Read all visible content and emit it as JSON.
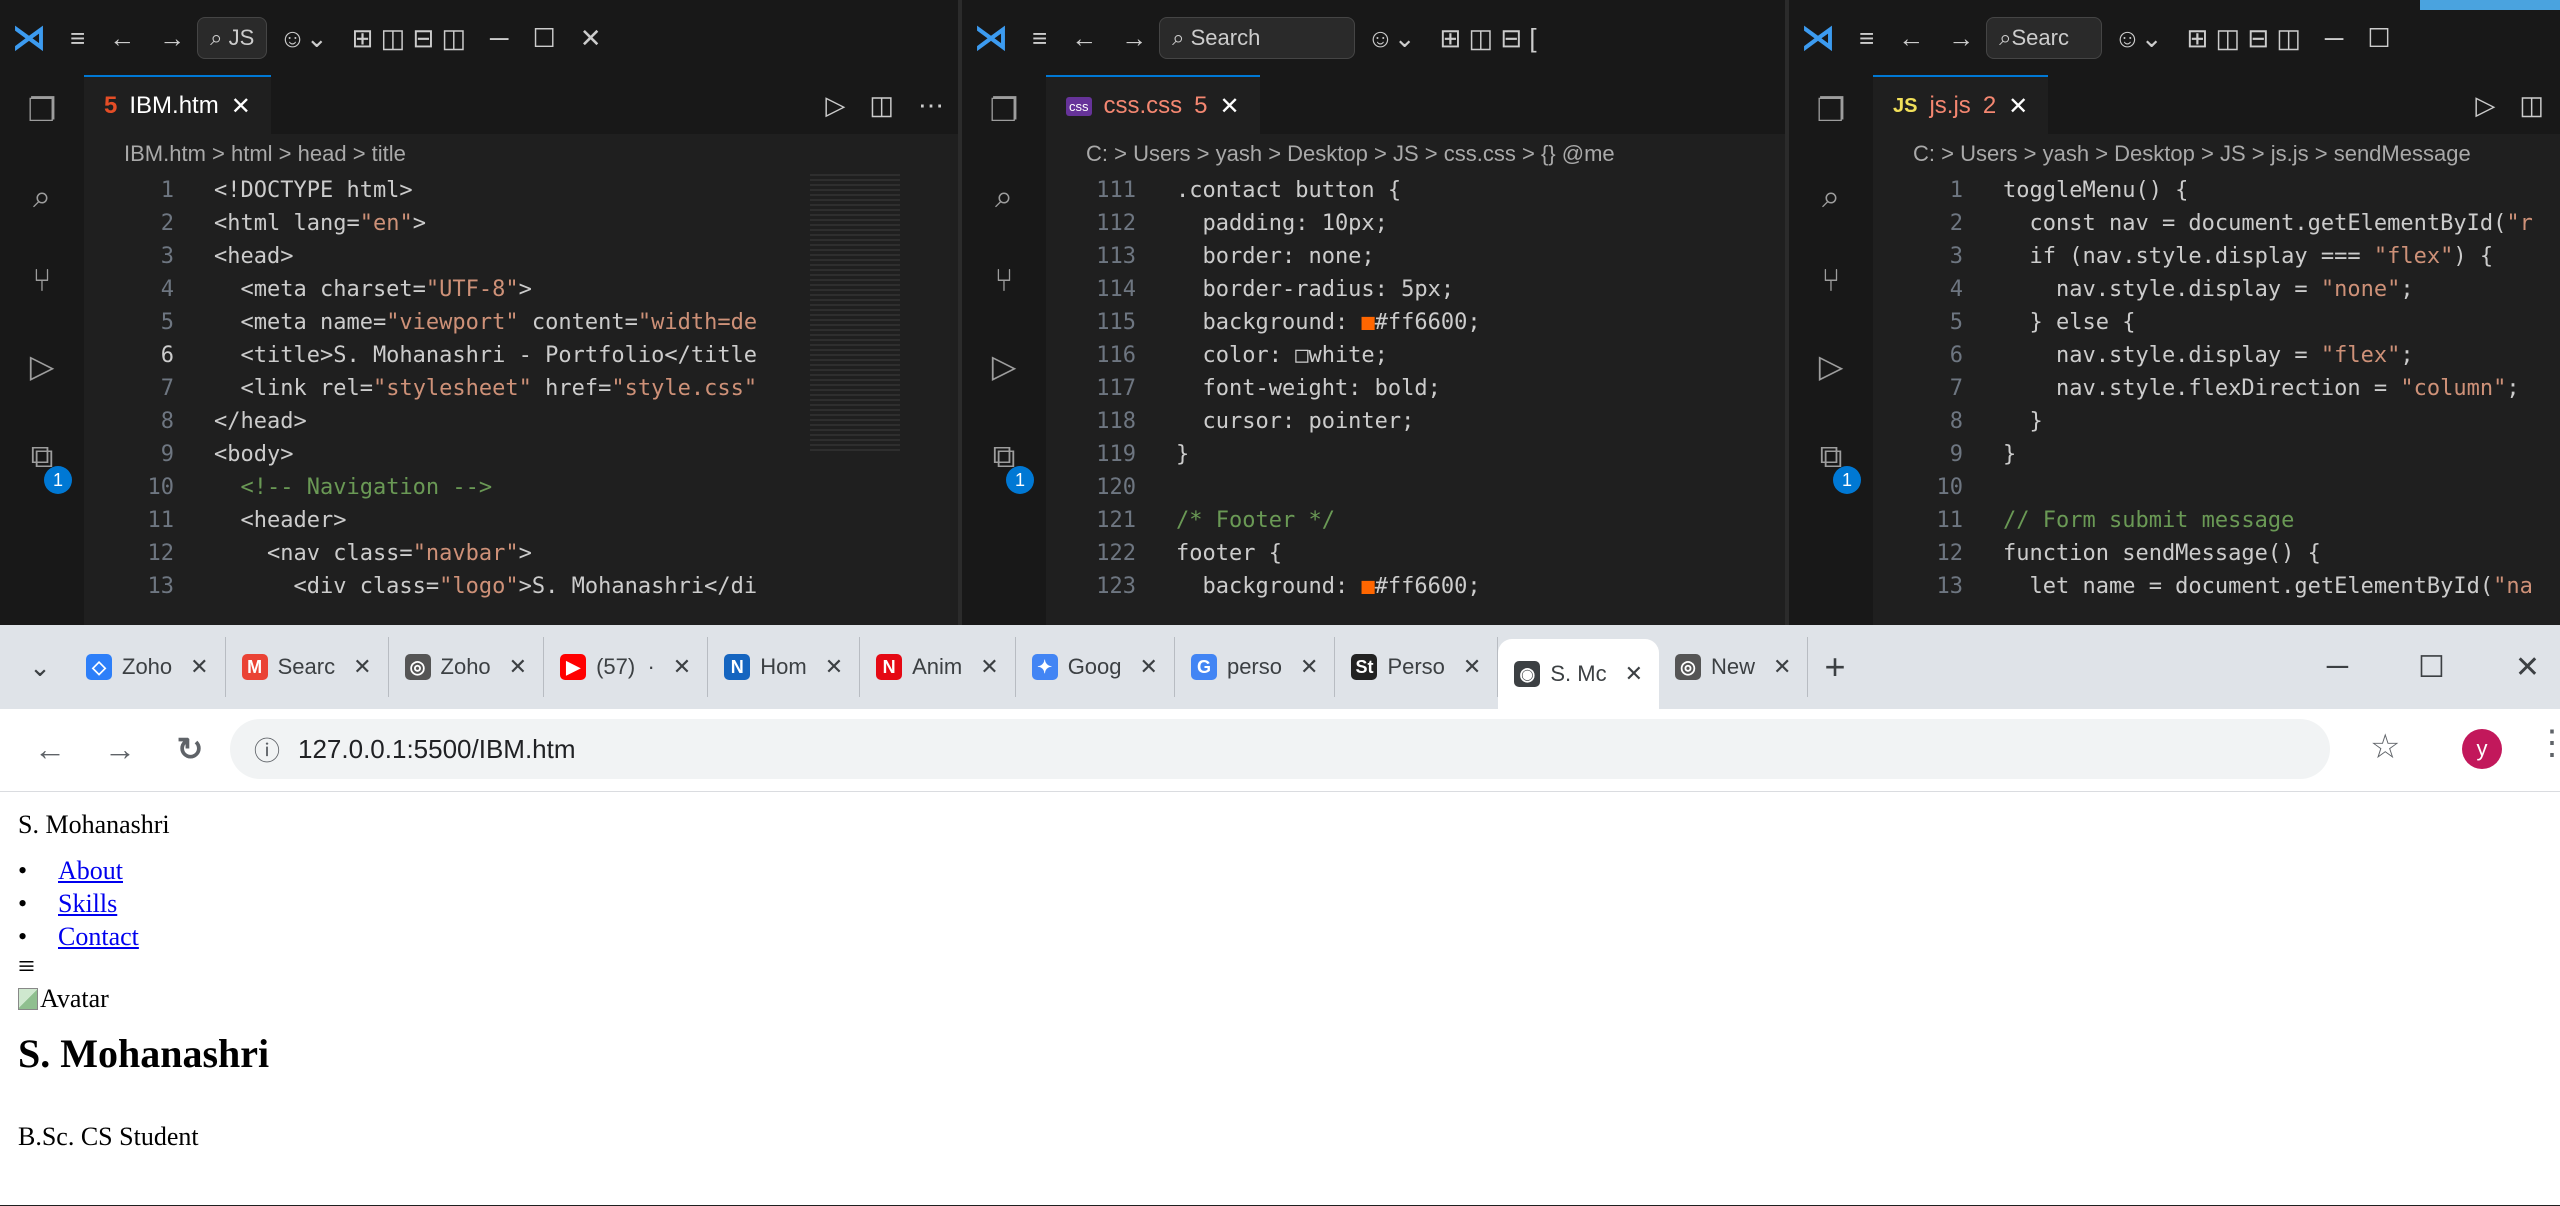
{
  "vscode": {
    "pane1": {
      "search": "JS",
      "tab": {
        "label": "IBM.htm",
        "icon": "html-file-icon"
      },
      "breadcrumb": [
        "IBM.htm",
        "html",
        "head",
        "title"
      ],
      "lines": [
        {
          "n": "1",
          "t": "<!DOCTYPE html>"
        },
        {
          "n": "2",
          "t": "<html lang=\"en\">"
        },
        {
          "n": "3",
          "t": "<head>"
        },
        {
          "n": "4",
          "t": "  <meta charset=\"UTF-8\">"
        },
        {
          "n": "5",
          "t": "  <meta name=\"viewport\" content=\"width=de"
        },
        {
          "n": "6",
          "t": "  <title>S. Mohanashri - Portfolio</title"
        },
        {
          "n": "7",
          "t": "  <link rel=\"stylesheet\" href=\"style.css\""
        },
        {
          "n": "8",
          "t": "</head>"
        },
        {
          "n": "9",
          "t": "<body>"
        },
        {
          "n": "10",
          "t": "  <!-- Navigation -->"
        },
        {
          "n": "11",
          "t": "  <header>"
        },
        {
          "n": "12",
          "t": "    <nav class=\"navbar\">"
        },
        {
          "n": "13",
          "t": "      <div class=\"logo\">S. Mohanashri</di"
        }
      ]
    },
    "pane2": {
      "search": "Search",
      "tab": {
        "label": "css.css",
        "count": "5",
        "icon": "css-file-icon"
      },
      "breadcrumb": [
        "C:",
        "Users",
        "yash",
        "Desktop",
        "JS",
        "css.css",
        "{} @me"
      ],
      "lines": [
        {
          "n": "111",
          "t": ".contact button {"
        },
        {
          "n": "112",
          "t": "  padding: 10px;"
        },
        {
          "n": "113",
          "t": "  border: none;"
        },
        {
          "n": "114",
          "t": "  border-radius: 5px;"
        },
        {
          "n": "115",
          "t": "  background: ■#ff6600;"
        },
        {
          "n": "116",
          "t": "  color: □white;"
        },
        {
          "n": "117",
          "t": "  font-weight: bold;"
        },
        {
          "n": "118",
          "t": "  cursor: pointer;"
        },
        {
          "n": "119",
          "t": "}"
        },
        {
          "n": "120",
          "t": ""
        },
        {
          "n": "121",
          "t": "/* Footer */"
        },
        {
          "n": "122",
          "t": "footer {"
        },
        {
          "n": "123",
          "t": "  background: ■#ff6600;"
        }
      ]
    },
    "pane3": {
      "search": "Searc",
      "tab": {
        "label": "js.js",
        "count": "2",
        "icon": "js-file-icon"
      },
      "breadcrumb": [
        "C:",
        "Users",
        "yash",
        "Desktop",
        "JS",
        "js.js",
        "sendMessage"
      ],
      "lines": [
        {
          "n": "1",
          "t": "toggleMenu() {"
        },
        {
          "n": "2",
          "t": "  const nav = document.getElementById(\"r"
        },
        {
          "n": "3",
          "t": "  if (nav.style.display === \"flex\") {"
        },
        {
          "n": "4",
          "t": "    nav.style.display = \"none\";"
        },
        {
          "n": "5",
          "t": "  } else {"
        },
        {
          "n": "6",
          "t": "    nav.style.display = \"flex\";"
        },
        {
          "n": "7",
          "t": "    nav.style.flexDirection = \"column\";"
        },
        {
          "n": "8",
          "t": "  }"
        },
        {
          "n": "9",
          "t": "}"
        },
        {
          "n": "10",
          "t": ""
        },
        {
          "n": "11",
          "t": "// Form submit message"
        },
        {
          "n": "12",
          "t": "function sendMessage() {"
        },
        {
          "n": "13",
          "t": "  let name = document.getElementById(\"na"
        }
      ]
    },
    "badge": "1"
  },
  "chrome": {
    "tabs": [
      {
        "label": "Zoho",
        "fav": "◇",
        "color": "#2d7ff9"
      },
      {
        "label": "Searc",
        "fav": "M",
        "color": "#ea4335"
      },
      {
        "label": "Zoho",
        "fav": "◎",
        "color": "#555555"
      },
      {
        "label": "(57)  ·",
        "fav": "▶",
        "color": "#ff0000"
      },
      {
        "label": "Hom",
        "fav": "N",
        "color": "#1565c0"
      },
      {
        "label": "Anim",
        "fav": "N",
        "color": "#e50914"
      },
      {
        "label": "Goog",
        "fav": "✦",
        "color": "#4285f4"
      },
      {
        "label": "perso",
        "fav": "G",
        "color": "#4285f4"
      },
      {
        "label": "Perso",
        "fav": "St",
        "color": "#222222"
      },
      {
        "label": "S. Mc",
        "fav": "◉",
        "color": "#3c4043",
        "active": true
      },
      {
        "label": "New",
        "fav": "◎",
        "color": "#555555"
      }
    ],
    "new_tab": "+",
    "url": "127.0.0.1:5500/IBM.htm",
    "profile_initial": "y"
  },
  "page": {
    "logo": "S. Mohanashri",
    "nav": [
      "About",
      "Skills",
      "Contact"
    ],
    "menu_icon": "≡",
    "avatar_alt": "Avatar",
    "heading": "S. Mohanashri",
    "subtitle": "B.Sc. CS Student"
  },
  "colors": {
    "keyword": "#569cd6",
    "attr": "#9cdcfe",
    "string": "#ce9178",
    "tag": "#808080",
    "comment": "#6a9955",
    "selector": "#d7ba7d",
    "function": "#dcdcaa",
    "swatch_orange": "#ff6600"
  }
}
